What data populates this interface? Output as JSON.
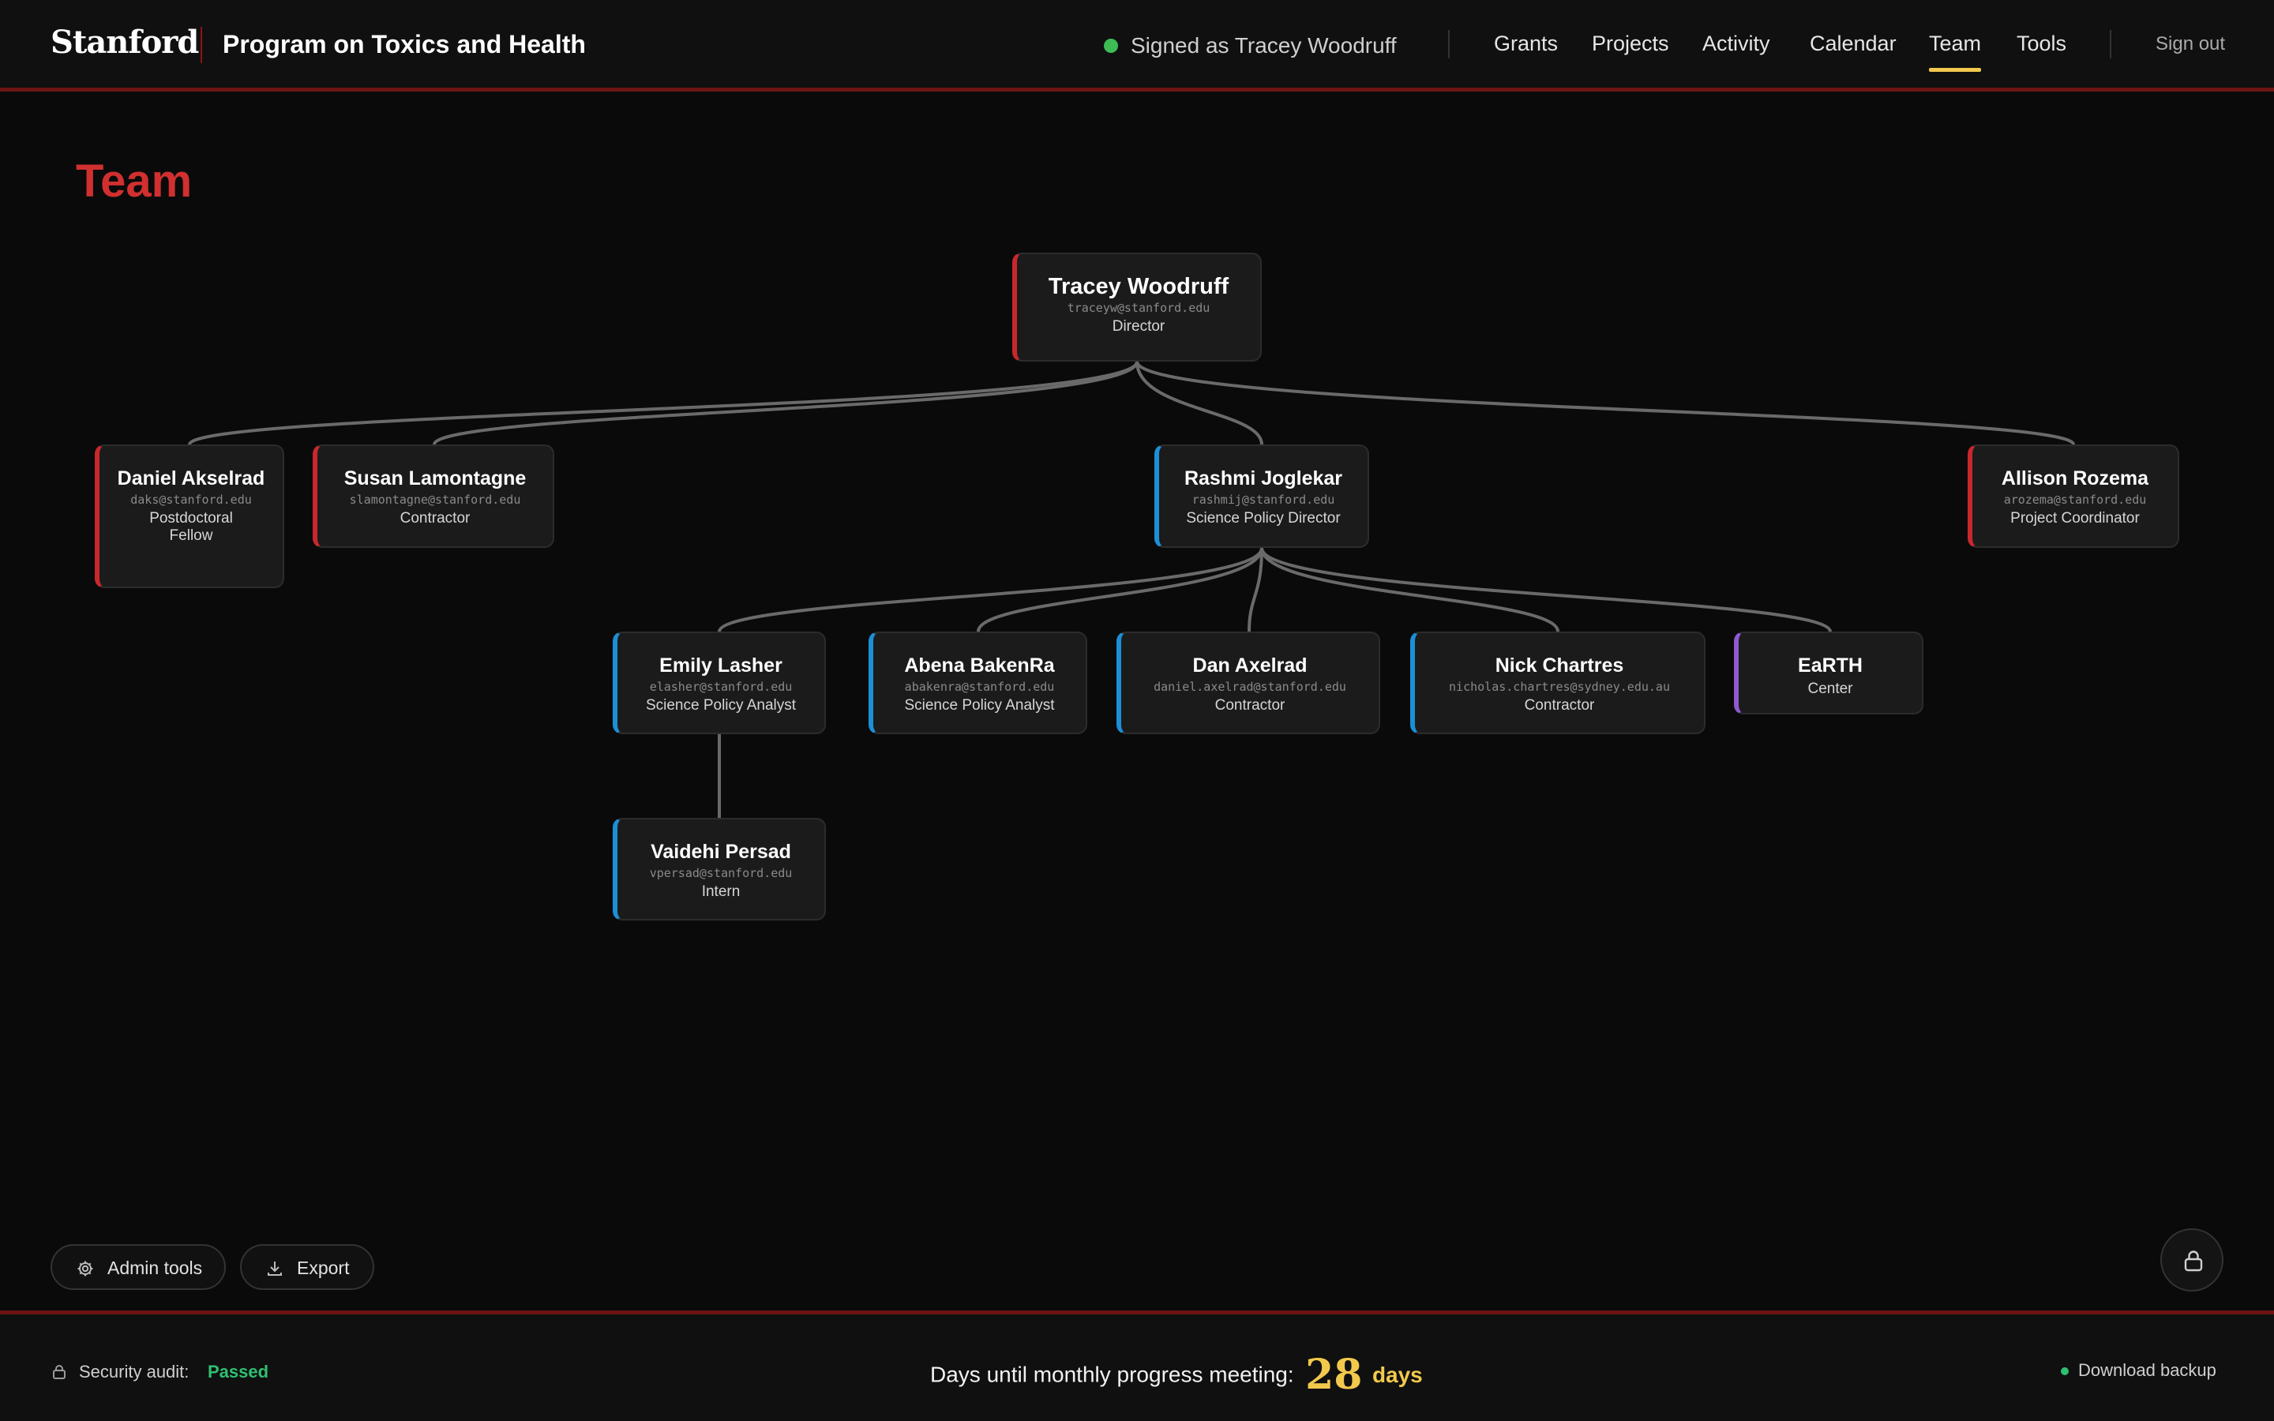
{
  "header": {
    "logo": "Stanford",
    "app_title": "Program on Toxics and Health",
    "signed_in": "Signed as Tracey Woodruff",
    "nav": [
      {
        "label": "Grants"
      },
      {
        "label": "Projects"
      },
      {
        "label": "Activity"
      },
      {
        "label": "Calendar"
      },
      {
        "label": "Team",
        "active": true
      },
      {
        "label": "Tools"
      }
    ],
    "sign_out": "Sign out"
  },
  "page": {
    "title": "Team"
  },
  "team": {
    "root": {
      "name": "Tracey Woodruff",
      "email": "traceyw@stanford.edu",
      "role": "Director"
    },
    "level1": [
      {
        "name": "Daniel Akselrad",
        "email": "daks@stanford.edu",
        "role": "Postdoctoral Fellow"
      },
      {
        "name": "Susan Lamontagne",
        "email": "slamontagne@stanford.edu",
        "role": "Contractor"
      },
      {
        "name": "Rashmi Joglekar",
        "email": "rashmij@stanford.edu",
        "role": "Science Policy Director"
      },
      {
        "name": "Allison Rozema",
        "email": "arozema@stanford.edu",
        "role": "Project Coordinator"
      }
    ],
    "level2": [
      {
        "name": "Emily Lasher",
        "email": "elasher@stanford.edu",
        "role": "Science Policy Analyst"
      },
      {
        "name": "Abena BakenRa",
        "email": "abakenra@stanford.edu",
        "role": "Science Policy Analyst"
      },
      {
        "name": "Dan Axelrad",
        "email": "daniel.axelrad@stanford.edu",
        "role": "Contractor"
      },
      {
        "name": "Nick Chartres",
        "email": "nicholas.chartres@sydney.edu.au",
        "role": "Contractor"
      },
      {
        "name": "EaRTH",
        "role": "Center"
      }
    ],
    "level3": [
      {
        "name": "Vaidehi Persad",
        "email": "vpersad@stanford.edu",
        "role": "Intern"
      }
    ]
  },
  "actions": {
    "admin_tools": "Admin tools",
    "export": "Export"
  },
  "footer": {
    "security_label": "Security audit:",
    "security_status": "Passed",
    "meeting_label": "Days until monthly progress meeting:",
    "meeting_days": "28",
    "meeting_unit": "days",
    "backup": "Download backup"
  },
  "colors": {
    "accent_red": "#c8282c",
    "accent_blue": "#1c8fd6",
    "accent_purple": "#8e59d1",
    "accent_gold": "#f2c94c",
    "status_green": "#2fbf71"
  }
}
